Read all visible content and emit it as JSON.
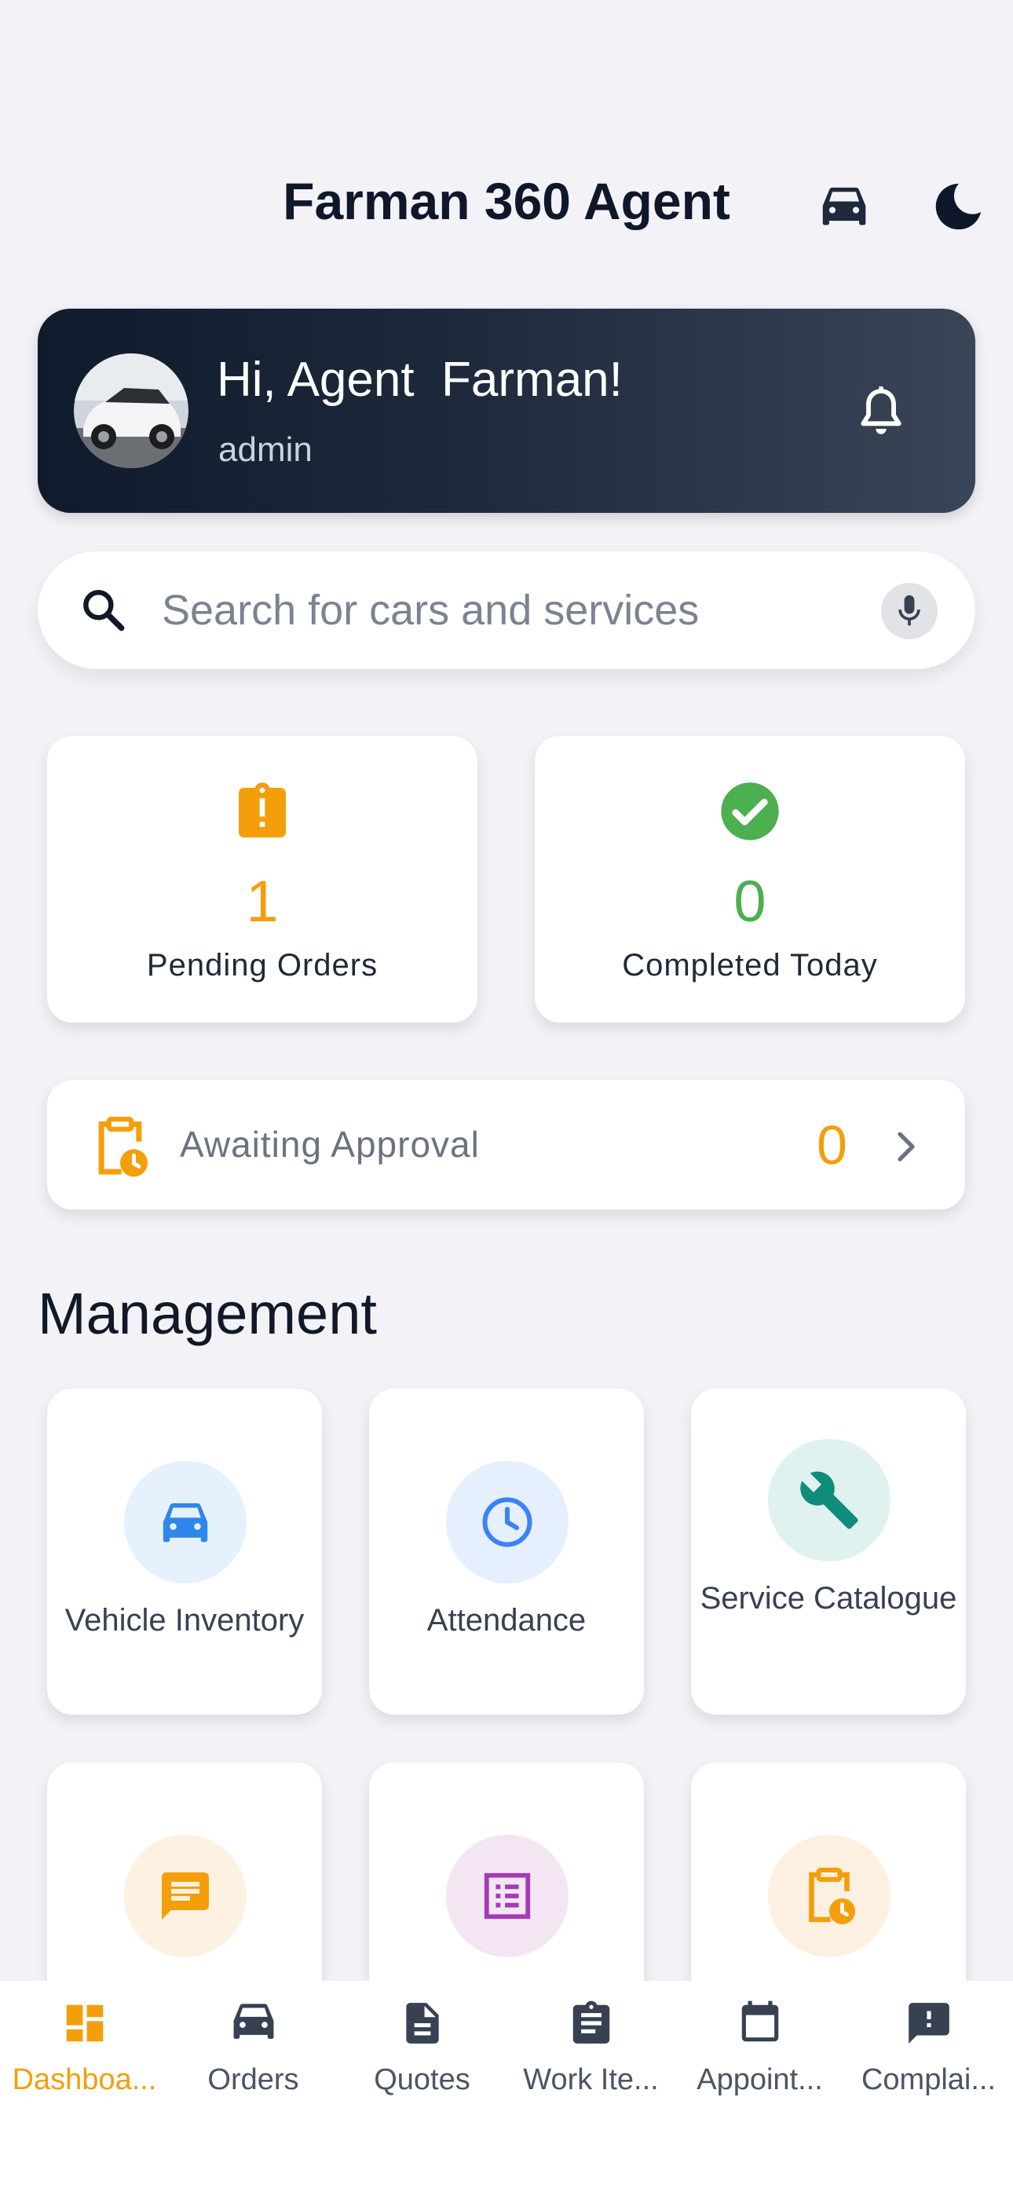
{
  "header": {
    "title": "Farman 360 Agent"
  },
  "greeting": {
    "text": "Hi, Agent  Farman!",
    "role": "admin"
  },
  "search": {
    "placeholder": "Search for cars and services"
  },
  "stats": {
    "pending": {
      "value": "1",
      "label": "Pending Orders",
      "color": "#f59e0b"
    },
    "completed": {
      "value": "0",
      "label": "Completed Today",
      "color": "#4caf50"
    }
  },
  "approval": {
    "label": "Awaiting Approval",
    "count": "0"
  },
  "management": {
    "title": "Management",
    "tiles": [
      {
        "label": "Vehicle Inventory",
        "icon": "car-icon"
      },
      {
        "label": "Attendance",
        "icon": "clock-icon"
      },
      {
        "label": "Service Catalogue",
        "icon": "wrench-icon"
      },
      {
        "label": "",
        "icon": "chat-icon"
      },
      {
        "label": "",
        "icon": "list-icon"
      },
      {
        "label": "",
        "icon": "clipboard-clock-icon"
      }
    ]
  },
  "nav": {
    "items": [
      {
        "label": "Dashboa...",
        "icon": "dashboard-icon",
        "active": true
      },
      {
        "label": "Orders",
        "icon": "car-icon"
      },
      {
        "label": "Quotes",
        "icon": "document-icon"
      },
      {
        "label": "Work Ite...",
        "icon": "clipboard-icon"
      },
      {
        "label": "Appoint...",
        "icon": "calendar-icon"
      },
      {
        "label": "Complai...",
        "icon": "feedback-icon"
      }
    ],
    "active_color": "#f59e0b"
  }
}
